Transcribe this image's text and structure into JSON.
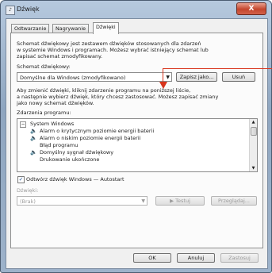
{
  "window": {
    "title": "Dźwięk",
    "close_label": "X"
  },
  "tabs": [
    {
      "label": "Odtwarzanie"
    },
    {
      "label": "Nagrywanie"
    },
    {
      "label": "Dźwięki"
    }
  ],
  "intro": {
    "line1": "Schemat dźwiękowy jest zestawem dźwięków stosowanych dla zdarzeń",
    "line2": "w systemie Windows i programach. Możesz wybrać istniejący schemat lub",
    "line3": "zapisać schemat zmodyfikowany."
  },
  "scheme": {
    "label": "Schemat dźwiękowy:",
    "value": "Domyślne dla Windows (zmodyfikowano)",
    "save_as": "Zapisz jako...",
    "delete": "Usuń"
  },
  "hint": {
    "line1": "Aby zmienić dźwięki, kliknij zdarzenie programu na poniższej liście,",
    "line2": "a następnie wybierz dźwięk, który chcesz zastosować. Możesz zapisać zmiany",
    "line3": "jako nowy schemat dźwięków."
  },
  "events": {
    "label": "Zdarzenia programu:",
    "group": "System Windows",
    "items": [
      "Alarm o krytycznym poziomie energii baterii",
      "Alarm o niskim poziomie energii baterii",
      "Błąd programu",
      "Domyślny sygnał dźwiękowy",
      "Drukowanie ukończone"
    ]
  },
  "startup": {
    "label": "Odtwórz dźwięk Windows — Autostart",
    "checked": true
  },
  "sounds": {
    "label": "Dźwięki:",
    "value": "(Brak)",
    "test": "Testuj",
    "browse": "Przeglądaj..."
  },
  "footer": {
    "ok": "OK",
    "cancel": "Anuluj",
    "apply": "Zastosuj"
  }
}
